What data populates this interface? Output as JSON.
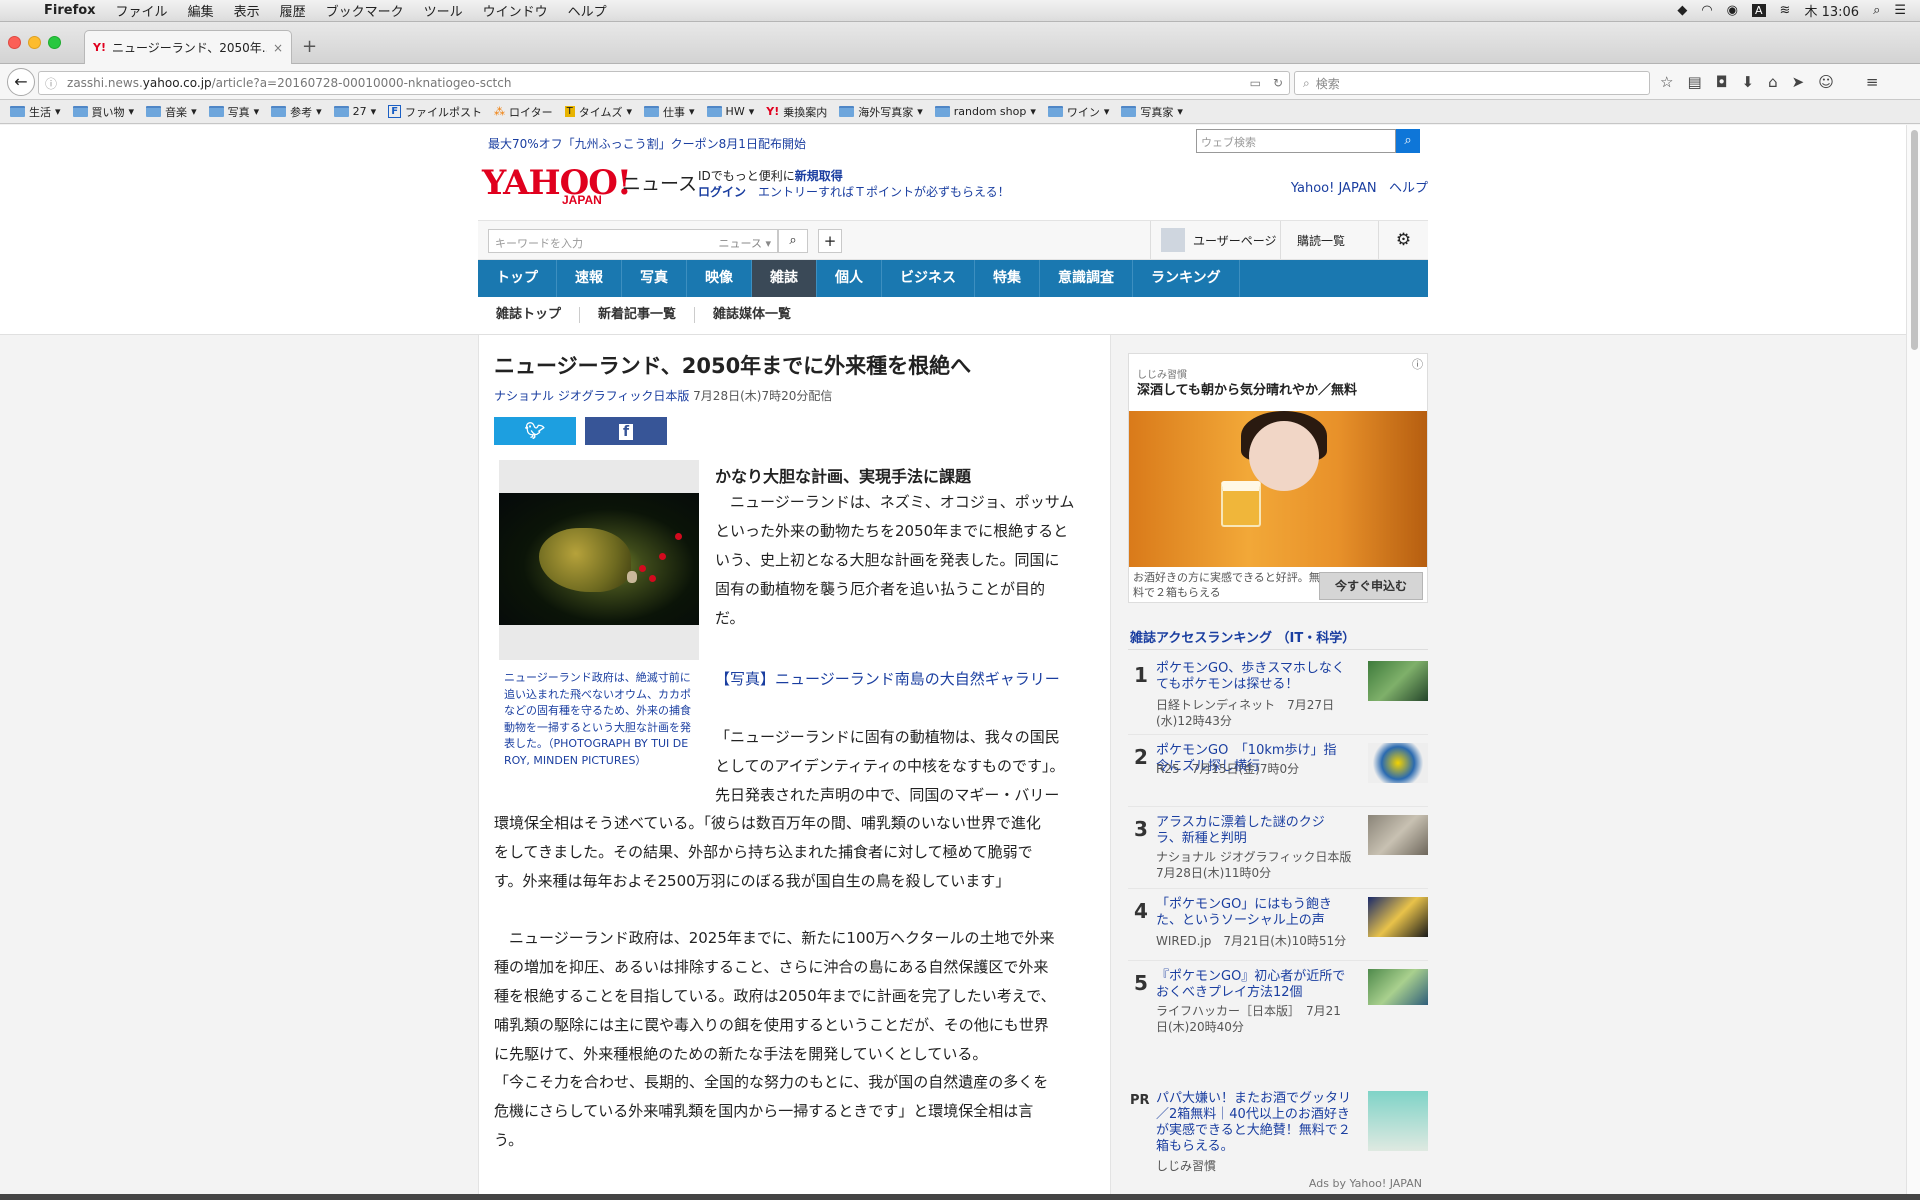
{
  "menubar": {
    "app": "Firefox",
    "items": [
      "ファイル",
      "編集",
      "表示",
      "履歴",
      "ブックマーク",
      "ツール",
      "ウインドウ",
      "ヘルプ"
    ],
    "clock": "木 13:06"
  },
  "tab": {
    "title": "ニュージーランド、2050年..."
  },
  "urlbar": {
    "prefix": "zasshi.news.",
    "host": "yahoo.co.jp",
    "path": "/article?a=20160728-00010000-nknatiogeo-sctch",
    "search_placeholder": "検索"
  },
  "bookmarks": [
    "生活",
    "買い物",
    "音楽",
    "写真",
    "参考",
    "27",
    "ファイルポスト",
    "ロイター",
    "タイムズ",
    "仕事",
    "HW",
    "乗換案内",
    "海外写真家",
    "random shop",
    "ワイン",
    "写真家"
  ],
  "yahoo": {
    "promo": "最大70%オフ「九州ふっこう割」クーポン8月1日配布開始",
    "web_search_placeholder": "ウェブ検索",
    "logo": "YAHOO!",
    "logo_sub": "JAPAN",
    "logo_news": "ニュース",
    "id_line1_pre": "IDでもっと便利に",
    "id_line1_link": "新規取得",
    "login": "ログイン",
    "tpoint": "エントリーすればＴポイントが必ずもらえる！",
    "yahoo_japan": "Yahoo! JAPAN",
    "help": "ヘルプ",
    "keyword_placeholder": "キーワードを入力",
    "keyword_scope": "ニュース",
    "user_page": "ユーザーページ",
    "subscriptions": "購読一覧"
  },
  "gnav": [
    "トップ",
    "速報",
    "写真",
    "映像",
    "雑誌",
    "個人",
    "ビジネス",
    "特集",
    "意識調査",
    "ランキング"
  ],
  "subnav": [
    "雑誌トップ",
    "新着記事一覧",
    "雑誌媒体一覧"
  ],
  "article": {
    "title": "ニュージーランド、2050年までに外来種を根絶へ",
    "source": "ナショナル ジオグラフィック日本版",
    "date": "7月28日(木)7時20分配信",
    "caption": "ニュージーランド政府は、絶滅寸前に追い込まれた飛べないオウム、カカポなどの固有種を守るため、外来の捕食動物を一掃するという大胆な計画を発表した。（PHOTOGRAPH BY TUI DE ROY, MINDEN PICTURES）",
    "subhead": "かなり大胆な計画、実現手法に課題",
    "p1": [
      "　ニュージーランドは、ネズミ、オコジョ、ポッサム",
      "といった外来の動物たちを2050年までに根絶すると",
      "いう、史上初となる大胆な計画を発表した。同国に",
      "固有の動植物を襲う厄介者を追い払うことが目的",
      "だ。"
    ],
    "gallery": "【写真】ニュージーランド南島の大自然ギャラリー",
    "p2a": [
      "「ニュージーランドに固有の動植物は、我々の国民",
      "としてのアイデンティティの中核をなすものです」。",
      "先日発表された声明の中で、同国のマギー・バリー"
    ],
    "p2b": [
      "環境保全相はそう述べている。「彼らは数百万年の間、哺乳類のいない世界で進化",
      "をしてきました。その結果、外部から持ち込まれた捕食者に対して極めて脆弱で",
      "す。外来種は毎年およそ2500万羽にのぼる我が国自生の鳥を殺しています」"
    ],
    "p3": [
      "　ニュージーランド政府は、2025年までに、新たに100万ヘクタールの土地で外来",
      "種の増加を抑圧、あるいは排除すること、さらに沖合の島にある自然保護区で外来",
      "種を根絶することを目指している。政府は2050年までに計画を完了したい考えで、",
      "哺乳類の駆除には主に罠や毒入りの餌を使用するということだが、その他にも世界",
      "に先駆けて、外来種根絶のための新たな手法を開発していくとしている。"
    ],
    "p4": [
      "「今こそ力を合わせ、長期的、全国的な努力のもとに、我が国の自然遺産の多くを",
      "危機にさらしている外来哺乳類を国内から一掃するときです」と環境保全相は言",
      "う。"
    ]
  },
  "sidebar": {
    "ad": {
      "sponsor": "しじみ習慣",
      "title": "深酒しても朝から気分晴れやか／無料",
      "desc": "お酒好きの方に実感できると好評。無料で２箱もらえる",
      "button": "今すぐ申込む"
    },
    "ranking_title": "雑誌アクセスランキング （IT・科学）",
    "ranking": [
      {
        "num": "1",
        "title": "ポケモンGO、歩きスマホしなくてもポケモンは探せる！",
        "source": "日経トレンディネット　7月27日(水)12時43分"
      },
      {
        "num": "2",
        "title": "ポケモンGO　「10km歩け」指令にズル探し横行",
        "source": "R25　7月15日(金)7時0分"
      },
      {
        "num": "3",
        "title": "アラスカに漂着した謎のクジラ、新種と判明",
        "source": "ナショナル ジオグラフィック日本版　7月28日(木)11時0分"
      },
      {
        "num": "4",
        "title": "「ポケモンGO」にはもう飽きた、というソーシャル上の声",
        "source": "WIRED.jp　7月21日(木)10時51分"
      },
      {
        "num": "5",
        "title": "『ポケモンGO』初心者が近所でおくべきプレイ方法12個",
        "source": "ライフハッカー［日本版］　7月21日(木)20時40分"
      }
    ],
    "pr": {
      "label": "PR",
      "title": "パパ大嫌い！またお酒でグッタリ／2箱無料｜40代以上のお酒好きが実感できると大絶賛！無料で２箱もらえる。",
      "source": "しじみ習慣"
    },
    "ads_by": "Ads by Yahoo! JAPAN"
  },
  "colors": {
    "accent": "#1a78b0",
    "link": "#1a3ea0",
    "brand": "#e0001e"
  }
}
